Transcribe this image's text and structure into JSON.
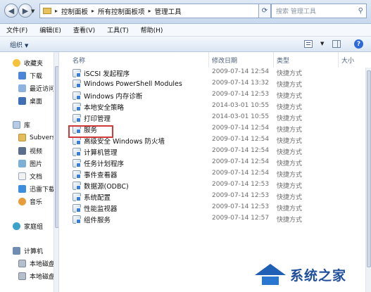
{
  "window": {
    "breadcrumbs": [
      "控制面板",
      "所有控制面板项",
      "管理工具"
    ],
    "search_placeholder": "搜索 管理工具"
  },
  "menubar": [
    "文件(F)",
    "编辑(E)",
    "查看(V)",
    "工具(T)",
    "帮助(H)"
  ],
  "toolbar": {
    "organize_label": "组织",
    "help_label": "?"
  },
  "navpane": {
    "favorites": {
      "label": "收藏夹",
      "items": [
        "下载",
        "最近访问",
        "桌面"
      ]
    },
    "libraries": {
      "label": "库",
      "items": [
        "Subvers",
        "视频",
        "图片",
        "文档",
        "迅雷下载",
        "音乐"
      ]
    },
    "homegroup": "家庭组",
    "computer": {
      "label": "计算机",
      "items": [
        "本地磁盘",
        "本地磁盘"
      ]
    }
  },
  "columns": {
    "name": "名称",
    "modified": "修改日期",
    "type": "类型",
    "size": "大小"
  },
  "files": [
    {
      "name": "iSCSI 发起程序",
      "date": "2009-07-14 12:54",
      "type": "快捷方式",
      "size": ""
    },
    {
      "name": "Windows PowerShell Modules",
      "date": "2009-07-14 13:32",
      "type": "快捷方式",
      "size": ""
    },
    {
      "name": "Windows 内存诊断",
      "date": "2009-07-14 12:53",
      "type": "快捷方式",
      "size": ""
    },
    {
      "name": "本地安全策略",
      "date": "2014-03-01 10:55",
      "type": "快捷方式",
      "size": ""
    },
    {
      "name": "打印管理",
      "date": "2014-03-01 10:55",
      "type": "快捷方式",
      "size": ""
    },
    {
      "name": "服务",
      "date": "2009-07-14 12:54",
      "type": "快捷方式",
      "size": ""
    },
    {
      "name": "高级安全 Windows 防火墙",
      "date": "2009-07-14 12:54",
      "type": "快捷方式",
      "size": ""
    },
    {
      "name": "计算机管理",
      "date": "2009-07-14 12:54",
      "type": "快捷方式",
      "size": ""
    },
    {
      "name": "任务计划程序",
      "date": "2009-07-14 12:54",
      "type": "快捷方式",
      "size": ""
    },
    {
      "name": "事件查看器",
      "date": "2009-07-14 12:54",
      "type": "快捷方式",
      "size": ""
    },
    {
      "name": "数据源(ODBC)",
      "date": "2009-07-14 12:53",
      "type": "快捷方式",
      "size": ""
    },
    {
      "name": "系统配置",
      "date": "2009-07-14 12:53",
      "type": "快捷方式",
      "size": ""
    },
    {
      "name": "性能监视器",
      "date": "2009-07-14 12:53",
      "type": "快捷方式",
      "size": ""
    },
    {
      "name": "组件服务",
      "date": "2009-07-14 12:57",
      "type": "快捷方式",
      "size": ""
    }
  ],
  "highlighted_file": "服务",
  "watermark": {
    "text": "系统之家"
  },
  "colors": {
    "highlight_border": "#d23a3a",
    "accent": "#1f5fb4"
  }
}
